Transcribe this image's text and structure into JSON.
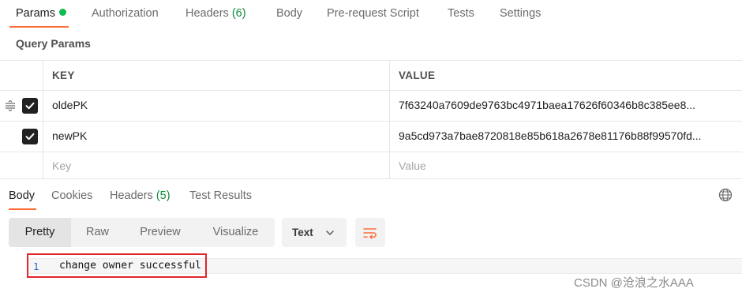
{
  "request_tabs": {
    "params": "Params",
    "authorization": "Authorization",
    "headers": "Headers",
    "headers_count": "(6)",
    "body": "Body",
    "pre_request": "Pre-request Script",
    "tests": "Tests",
    "settings": "Settings"
  },
  "query_params": {
    "title": "Query Params",
    "columns": {
      "key": "KEY",
      "value": "VALUE"
    },
    "rows": [
      {
        "key": "oldePK",
        "value": "7f63240a7609de9763bc4971baea17626f60346b8c385ee8...",
        "checked": true
      },
      {
        "key": "newPK",
        "value": "9a5cd973a7bae8720818e85b618a2678e81176b88f99570fd...",
        "checked": true
      }
    ],
    "placeholder": {
      "key": "Key",
      "value": "Value"
    }
  },
  "response_tabs": {
    "body": "Body",
    "cookies": "Cookies",
    "headers": "Headers",
    "headers_count": "(5)",
    "test_results": "Test Results"
  },
  "view_modes": [
    "Pretty",
    "Raw",
    "Preview",
    "Visualize"
  ],
  "active_view": "Pretty",
  "format": "Text",
  "response_body": {
    "line_number": "1",
    "text": "change owner successful"
  },
  "watermark": "CSDN @沧浪之水AAA",
  "colors": {
    "accent": "#ff6c37",
    "success_dot": "#0cbb52",
    "count_green": "#0f8a3c",
    "highlight_box": "#e0262e",
    "line_number": "#2a6cc2"
  },
  "icons": [
    "drag-handle-icon",
    "check-icon",
    "globe-icon",
    "chevron-down-icon",
    "wrap-lines-icon"
  ]
}
